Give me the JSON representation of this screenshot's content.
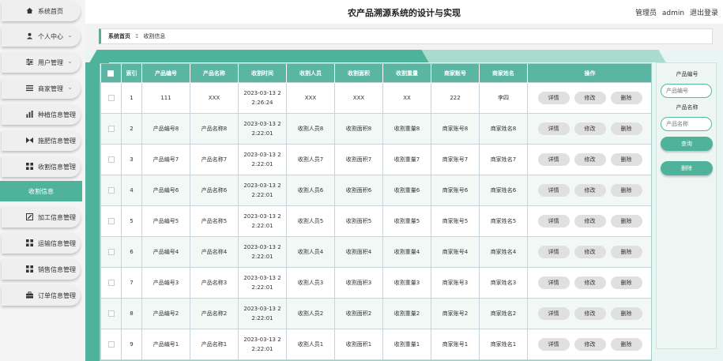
{
  "app": {
    "title": "农产品溯源系统的设计与实现"
  },
  "user": {
    "role": "管理员",
    "name": "admin",
    "logout": "退出登录"
  },
  "breadcrumb": {
    "home": "系统首页",
    "separator": "Ξ",
    "current": "收割信息"
  },
  "sidebar": {
    "items": [
      {
        "label": "系统首页",
        "icon": "home-icon"
      },
      {
        "label": "个人中心",
        "icon": "person-icon",
        "chevron": "⌄"
      },
      {
        "label": "用户管理",
        "icon": "sliders-icon",
        "chevron": "⌄"
      },
      {
        "label": "商家管理",
        "icon": "list-icon",
        "chevron": "⌄"
      },
      {
        "label": "种植信息管理",
        "icon": "chart-icon",
        "chevron": "⌄"
      },
      {
        "label": "施肥信息管理",
        "icon": "video-icon",
        "chevron": "⌄"
      },
      {
        "label": "收割信息管理",
        "icon": "grid-icon",
        "chevron": "⌃"
      },
      {
        "label": "加工信息管理",
        "icon": "edit-icon",
        "chevron": "⌄"
      },
      {
        "label": "运输信息管理",
        "icon": "grid-icon",
        "chevron": "⌄"
      },
      {
        "label": "销售信息管理",
        "icon": "grid-icon",
        "chevron": "⌄"
      },
      {
        "label": "订单信息管理",
        "icon": "briefcase-icon",
        "chevron": "⌄"
      }
    ],
    "active_sub": "收割信息"
  },
  "table": {
    "headers": [
      "索引",
      "产品编号",
      "产品名称",
      "收割时间",
      "收割人员",
      "收割面积",
      "收割重量",
      "商家账号",
      "商家姓名",
      "操作"
    ],
    "actions": [
      "详情",
      "修改",
      "删除"
    ],
    "rows": [
      {
        "index": "1",
        "product_no": "111",
        "product_name": "XXX",
        "time_line1": "2023-03-13 2",
        "time_line2": "2:26:24",
        "harvester": "XXX",
        "area": "XXX",
        "weight": "XX",
        "merchant_account": "222",
        "merchant_name": "李四"
      },
      {
        "index": "2",
        "product_no": "产品编号8",
        "product_name": "产品名称8",
        "time_line1": "2023-03-13 2",
        "time_line2": "2:22:01",
        "harvester": "收割人员8",
        "area": "收割面积8",
        "weight": "收割重量8",
        "merchant_account": "商家账号8",
        "merchant_name": "商家姓名8"
      },
      {
        "index": "3",
        "product_no": "产品编号7",
        "product_name": "产品名称7",
        "time_line1": "2023-03-13 2",
        "time_line2": "2:22:01",
        "harvester": "收割人员7",
        "area": "收割面积7",
        "weight": "收割重量7",
        "merchant_account": "商家账号7",
        "merchant_name": "商家姓名7"
      },
      {
        "index": "4",
        "product_no": "产品编号6",
        "product_name": "产品名称6",
        "time_line1": "2023-03-13 2",
        "time_line2": "2:22:01",
        "harvester": "收割人员6",
        "area": "收割面积6",
        "weight": "收割重量6",
        "merchant_account": "商家账号6",
        "merchant_name": "商家姓名6"
      },
      {
        "index": "5",
        "product_no": "产品编号5",
        "product_name": "产品名称5",
        "time_line1": "2023-03-13 2",
        "time_line2": "2:22:01",
        "harvester": "收割人员5",
        "area": "收割面积5",
        "weight": "收割重量5",
        "merchant_account": "商家账号5",
        "merchant_name": "商家姓名5"
      },
      {
        "index": "6",
        "product_no": "产品编号4",
        "product_name": "产品名称4",
        "time_line1": "2023-03-13 2",
        "time_line2": "2:22:01",
        "harvester": "收割人员4",
        "area": "收割面积4",
        "weight": "收割重量4",
        "merchant_account": "商家账号4",
        "merchant_name": "商家姓名4"
      },
      {
        "index": "7",
        "product_no": "产品编号3",
        "product_name": "产品名称3",
        "time_line1": "2023-03-13 2",
        "time_line2": "2:22:01",
        "harvester": "收割人员3",
        "area": "收割面积3",
        "weight": "收割重量3",
        "merchant_account": "商家账号3",
        "merchant_name": "商家姓名3"
      },
      {
        "index": "8",
        "product_no": "产品编号2",
        "product_name": "产品名称2",
        "time_line1": "2023-03-13 2",
        "time_line2": "2:22:01",
        "harvester": "收割人员2",
        "area": "收割面积2",
        "weight": "收割重量2",
        "merchant_account": "商家账号2",
        "merchant_name": "商家姓名2"
      },
      {
        "index": "9",
        "product_no": "产品编号1",
        "product_name": "产品名称1",
        "time_line1": "2023-03-13 2",
        "time_line2": "2:22:01",
        "harvester": "收割人员1",
        "area": "收割面积1",
        "weight": "收割重量1",
        "merchant_account": "商家账号1",
        "merchant_name": "商家姓名1"
      }
    ]
  },
  "search": {
    "product_no_label": "产品编号",
    "product_no_placeholder": "产品编号",
    "product_name_label": "产品名称",
    "product_name_placeholder": "产品名称",
    "search_button": "查询",
    "delete_button": "删除"
  },
  "colors": {
    "accent": "#4fb39c",
    "header": "#5ab5a2",
    "accent_light": "#a9dccf"
  }
}
